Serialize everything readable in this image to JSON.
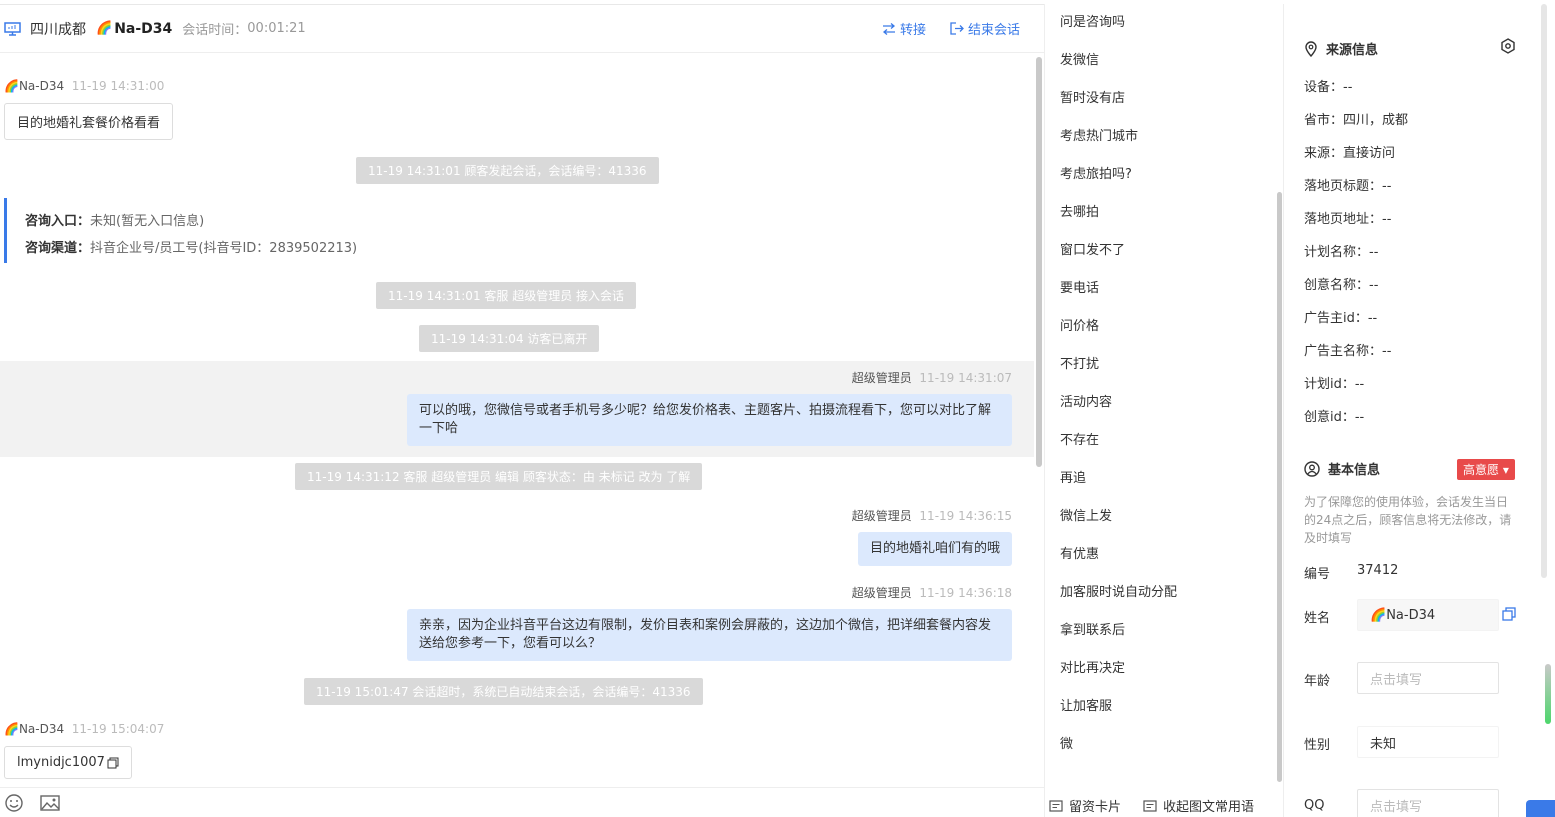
{
  "header": {
    "location": "四川成都",
    "visitor_name": "Na-D34",
    "session_time_label": "会话时间：",
    "session_time": "00:01:21",
    "transfer_label": "转接",
    "end_label": "结束会话"
  },
  "messages": {
    "v1_name": "Na-D34",
    "v1_time": "11-19 14:31:00",
    "v1_text": "目的地婚礼套餐价格看看",
    "sys1": "11-19 14:31:01 顾客发起会话，会话编号：41336",
    "info_entry_label": "咨询入口：",
    "info_entry_value": "未知(暂无入口信息)",
    "info_channel_label": "咨询渠道：",
    "info_channel_value": "抖音企业号/员工号(抖音号ID：2839502213)",
    "sys2": "11-19 14:31:01 客服 超级管理员 接入会话",
    "sys3": "11-19 14:31:04 访客已离开",
    "a1_name": "超级管理员",
    "a1_time": "11-19 14:31:07",
    "a1_text": "可以的哦，您微信号或者手机号多少呢？给您发价格表、主题客片、拍摄流程看下，您可以对比了解一下哈",
    "sys4": "11-19 14:31:12 客服 超级管理员 编辑 顾客状态：由 未标记 改为 了解",
    "a2_name": "超级管理员",
    "a2_time": "11-19 14:36:15",
    "a2_text": "目的地婚礼咱们有的哦",
    "a3_name": "超级管理员",
    "a3_time": "11-19 14:36:18",
    "a3_text": "亲亲，因为企业抖音平台这边有限制，发价目表和案例会屏蔽的，这边加个微信，把详细套餐内容发送给您参考一下，您看可以么？",
    "sys5": "11-19 15:01:47 会话超时，系统已自动结束会话，会话编号：41336",
    "v2_name": "Na-D34",
    "v2_time": "11-19 15:04:07",
    "v2_text": "lmynidjc1007"
  },
  "quick_replies": [
    "问是咨询吗",
    "发微信",
    "暂时没有店",
    "考虑热门城市",
    "考虑旅拍吗?",
    "去哪拍",
    "窗口发不了",
    "要电话",
    "问价格",
    "不打扰",
    "活动内容",
    "不存在",
    "再追",
    "微信上发",
    "有优惠",
    "加客服时说自动分配",
    "拿到联系后",
    "对比再决定",
    "让加客服",
    "微"
  ],
  "quick_footer": {
    "card_label": "留资卡片",
    "collapse_label": "收起图文常用语"
  },
  "source": {
    "title": "来源信息",
    "rows": [
      "设备：--",
      "省市：四川，成都",
      "来源：直接访问",
      "落地页标题：--",
      "落地页地址：--",
      "计划名称：--",
      "创意名称：--",
      "广告主id：--",
      "广告主名称：--",
      "计划id：--",
      "创意id：--"
    ]
  },
  "basic": {
    "title": "基本信息",
    "intent_tag": "高意愿",
    "note": "为了保障您的使用体验，会话发生当日的24点之后，顾客信息将无法修改，请及时填写",
    "id_label": "编号",
    "id_value": "37412",
    "name_label": "姓名",
    "name_value": "Na-D34",
    "age_label": "年龄",
    "age_placeholder": "点击填写",
    "gender_label": "性别",
    "gender_value": "未知",
    "qq_label": "QQ",
    "qq_placeholder": "点击填写"
  },
  "colors": {
    "accent": "#3a7ae8",
    "agent_bubble": "#dce9fd",
    "tag_red": "#e84a4a"
  }
}
